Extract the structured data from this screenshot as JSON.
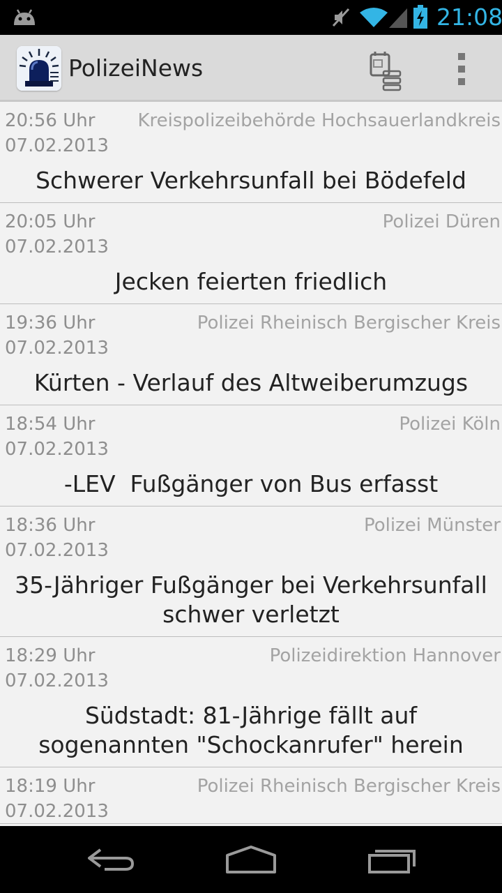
{
  "status_bar": {
    "time": "21:08",
    "icons": [
      "android-icon",
      "mute-icon",
      "wifi-icon",
      "signal-icon",
      "battery-charging-icon"
    ],
    "accent_color": "#33b5e5"
  },
  "action_bar": {
    "title": "PolizeiNews",
    "actions": [
      "list-toggle-icon",
      "overflow-menu-icon"
    ]
  },
  "news": [
    {
      "time": "20:56 Uhr",
      "date": "07.02.2013",
      "source": "Kreispolizeibehörde Hochsauerlandkreis",
      "headline": "Schwerer Verkehrsunfall bei Bödefeld"
    },
    {
      "time": "20:05 Uhr",
      "date": "07.02.2013",
      "source": "Polizei Düren",
      "headline": "Jecken feierten friedlich"
    },
    {
      "time": "19:36 Uhr",
      "date": "07.02.2013",
      "source": "Polizei Rheinisch Bergischer Kreis",
      "headline": "Kürten - Verlauf des Altweiberumzugs"
    },
    {
      "time": "18:54 Uhr",
      "date": "07.02.2013",
      "source": "Polizei Köln",
      "headline": "-LEV  Fußgänger von Bus erfasst"
    },
    {
      "time": "18:36 Uhr",
      "date": "07.02.2013",
      "source": "Polizei Münster",
      "headline": "35-Jähriger Fußgänger bei Verkehrsunfall schwer verletzt"
    },
    {
      "time": "18:29 Uhr",
      "date": "07.02.2013",
      "source": "Polizeidirektion Hannover",
      "headline": "Südstadt: 81-Jährige fällt auf sogenannten \"Schockanrufer\" herein"
    },
    {
      "time": "18:19 Uhr",
      "date": "07.02.2013",
      "source": "Polizei Rheinisch Bergischer Kreis",
      "headline": ""
    }
  ],
  "nav_bar": {
    "buttons": [
      "back-icon",
      "home-icon",
      "recent-apps-icon"
    ]
  }
}
